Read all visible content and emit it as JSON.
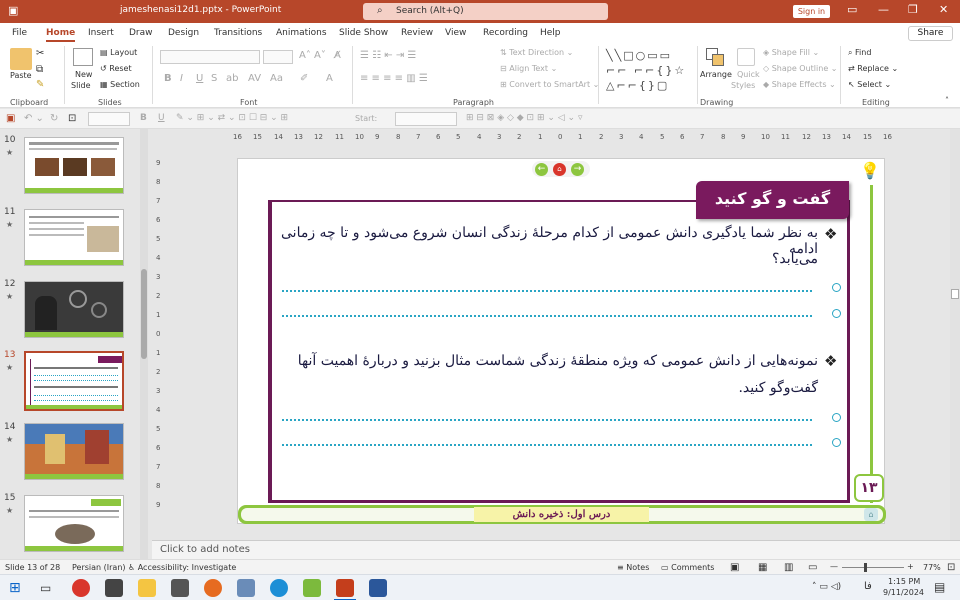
{
  "window": {
    "title": "jameshenasi12d1.pptx  -  PowerPoint",
    "search_placeholder": "Search (Alt+Q)",
    "signin": "Sign in"
  },
  "menu": {
    "items": [
      "File",
      "Home",
      "Insert",
      "Draw",
      "Design",
      "Transitions",
      "Animations",
      "Slide Show",
      "Review",
      "View",
      "Recording",
      "Help"
    ],
    "active": "Home",
    "share": "Share"
  },
  "ribbon": {
    "clipboard": {
      "paste": "Paste",
      "label": "Clipboard"
    },
    "slides": {
      "new_slide": "New",
      "new_slide2": "Slide",
      "layout": "Layout",
      "reset": "Reset",
      "section": "Section",
      "label": "Slides"
    },
    "font": {
      "label": "Font"
    },
    "paragraph": {
      "text_direction": "Text Direction",
      "align_text": "Align Text",
      "smartart": "Convert to SmartArt",
      "label": "Paragraph"
    },
    "drawing": {
      "arrange": "Arrange",
      "quick_styles": "Quick",
      "quick_styles2": "Styles",
      "shape_fill": "Shape Fill",
      "shape_outline": "Shape Outline",
      "shape_effects": "Shape Effects",
      "label": "Drawing"
    },
    "editing": {
      "find": "Find",
      "replace": "Replace",
      "select": "Select",
      "label": "Editing"
    }
  },
  "qat": {
    "start_label": "Start:"
  },
  "thumbnails": [
    {
      "num": "10",
      "selected": false
    },
    {
      "num": "11",
      "selected": false
    },
    {
      "num": "12",
      "selected": false
    },
    {
      "num": "13",
      "selected": true
    },
    {
      "num": "14",
      "selected": false
    },
    {
      "num": "15",
      "selected": false
    }
  ],
  "ruler": {
    "ticks": [
      "16",
      "15",
      "14",
      "13",
      "12",
      "11",
      "10",
      "9",
      "8",
      "7",
      "6",
      "5",
      "4",
      "3",
      "2",
      "1",
      "0",
      "1",
      "2",
      "3",
      "4",
      "5",
      "6",
      "7",
      "8",
      "9",
      "10",
      "11",
      "12",
      "13",
      "14",
      "15",
      "16"
    ]
  },
  "slide": {
    "heading": "گفت و گو کنید",
    "q1_line1": "به نظر شما یادگیری دانش عمومی از کدام مرحلهٔ زندگی انسان شروع می‌شود و تا چه زمانی ادامه",
    "q1_line2": "می‌یابد؟",
    "q2_line1": "نمونه‌هایی از دانش عمومی که ویژه منطقهٔ زندگی شماست مثال بزنید و دربارهٔ اهمیت آنها",
    "q2_line2": "گفت‌وگو کنید.",
    "page_number": "۱۳",
    "footer_label": "درس اول: ذخیره دانش",
    "bullet": "❖"
  },
  "notes_placeholder": "Click to add notes",
  "status": {
    "slide_info": "Slide 13 of 28",
    "language": "Persian (Iran)",
    "accessibility": "Accessibility: Investigate",
    "notes": "Notes",
    "comments": "Comments",
    "zoom": "77%"
  },
  "taskbar": {
    "time": "1:15 PM",
    "date": "9/11/2024",
    "lang": "فا"
  },
  "colors": {
    "accent": "#b7472a",
    "slide_frame": "#6b1a55",
    "heading_bg": "#7a1a5e",
    "green_bar": "#8dc63f",
    "footer_yellow": "#f7f3a8",
    "dotted": "#2aa5c4"
  }
}
